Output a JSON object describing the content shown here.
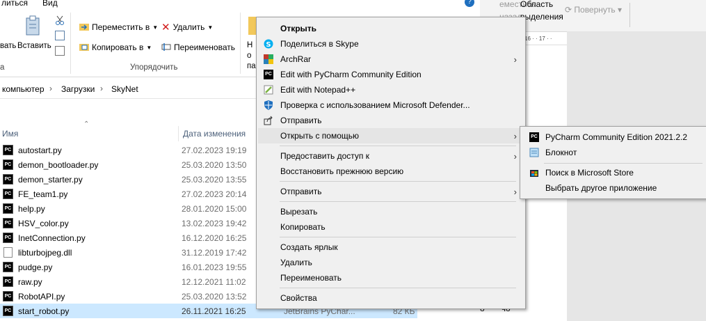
{
  "ribbon": {
    "tabs": [
      "литься",
      "Вид"
    ],
    "paste_left": "вать",
    "paste": "Вставить",
    "move_to": "Переместить в",
    "copy_to": "Копировать в",
    "delete": "Удалить",
    "rename": "Переименовать",
    "new_folder": "Но па",
    "group_organize": "Упорядочить",
    "group_clipboard": "а"
  },
  "address": {
    "crumbs": [
      "компьютер",
      "Загрузки",
      "SkyNet"
    ]
  },
  "columns": {
    "name": "Имя",
    "date": "Дата изменения"
  },
  "files": [
    {
      "name": "autostart.py",
      "date": "27.02.2023 19:19",
      "icon": "pycharm-file-icon"
    },
    {
      "name": "demon_bootloader.py",
      "date": "25.03.2020 13:50",
      "icon": "pycharm-file-icon"
    },
    {
      "name": "demon_starter.py",
      "date": "25.03.2020 13:55",
      "icon": "pycharm-file-icon"
    },
    {
      "name": "FE_team1.py",
      "date": "27.02.2023 20:14",
      "icon": "pycharm-file-icon"
    },
    {
      "name": "help.py",
      "date": "28.01.2020 15:00",
      "icon": "pycharm-file-icon"
    },
    {
      "name": "HSV_color.py",
      "date": "13.02.2023 19:42",
      "icon": "pycharm-file-icon"
    },
    {
      "name": "InetConnection.py",
      "date": "16.12.2020 16:25",
      "icon": "pycharm-file-icon"
    },
    {
      "name": "libturbojpeg.dll",
      "date": "31.12.2019 17:42",
      "icon": "dll-file-icon"
    },
    {
      "name": "pudge.py",
      "date": "16.01.2023 19:55",
      "icon": "pycharm-file-icon"
    },
    {
      "name": "raw.py",
      "date": "12.12.2021 11:02",
      "icon": "pycharm-file-icon"
    },
    {
      "name": "RobotAPI.py",
      "date": "25.03.2020 13:52",
      "icon": "pycharm-file-icon"
    },
    {
      "name": "start_robot.py",
      "date": "26.11.2021 16:25",
      "icon": "pycharm-file-icon",
      "type": "JetBrains PyChar...",
      "size": "82 КБ"
    }
  ],
  "doc": {
    "top_left": "еместить назад",
    "top_area": "Область выделения",
    "rotate": "Повернуть",
    "ruler": "16 · · 17 · ·",
    "bottom_text": "о ~ ~ чо"
  },
  "menu": {
    "items": [
      "Открыть",
      "Поделиться в Skype",
      "ArchRar",
      "Edit with PyCharm Community Edition",
      "Edit with Notepad++",
      "Проверка с использованием Microsoft Defender...",
      "Отправить",
      "Открыть с помощью",
      "Предоставить доступ к",
      "Восстановить прежнюю версию",
      "Отправить",
      "Вырезать",
      "Копировать",
      "Создать ярлык",
      "Удалить",
      "Переименовать",
      "Свойства"
    ]
  },
  "submenu": {
    "items": [
      "PyCharm Community Edition 2021.2.2",
      "Блокнот",
      "Поиск в Microsoft Store",
      "Выбрать другое приложение"
    ]
  },
  "colors": {
    "selection": "#cce8ff",
    "menu_bg": "#f0f0f0",
    "accent": "#0078d7"
  }
}
